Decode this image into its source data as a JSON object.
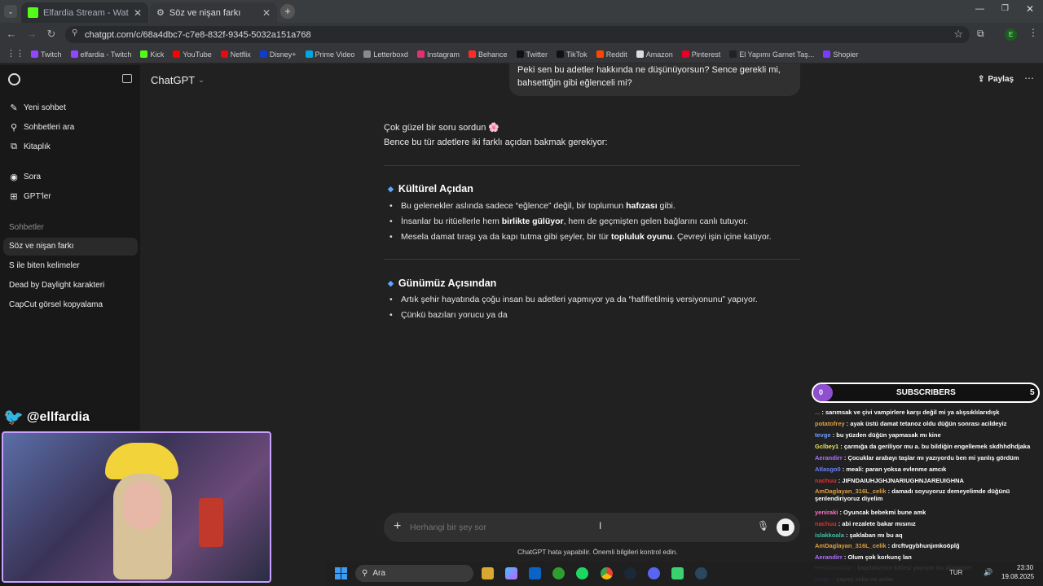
{
  "browser": {
    "tabs": [
      {
        "title": "Elfardia Stream - Watch Live or",
        "close": "✕",
        "active": false,
        "fav_color": "#53fc18"
      },
      {
        "title": "Söz ve nişan farkı",
        "close": "✕",
        "active": true,
        "fav_color": "#999999"
      }
    ],
    "new_tab": "+",
    "url": "chatgpt.com/c/68a4dbc7-c7e8-832f-9345-5032a151a768",
    "profile_letter": "E",
    "bookmarks": [
      {
        "label": "Twitch",
        "color": "#9146ff"
      },
      {
        "label": "elfardia - Twitch",
        "color": "#9146ff"
      },
      {
        "label": "Kick",
        "color": "#53fc18"
      },
      {
        "label": "YouTube",
        "color": "#ff0000"
      },
      {
        "label": "Netflix",
        "color": "#e50914"
      },
      {
        "label": "Disney+",
        "color": "#113ccf"
      },
      {
        "label": "Prime Video",
        "color": "#00a8e1"
      },
      {
        "label": "Letterboxd",
        "color": "#8a8a8a"
      },
      {
        "label": "Instagram",
        "color": "#e1306c"
      },
      {
        "label": "Behance",
        "color": "#ff2b2b"
      },
      {
        "label": "Twitter",
        "color": "#111111"
      },
      {
        "label": "TikTok",
        "color": "#111111"
      },
      {
        "label": "Reddit",
        "color": "#ff4500"
      },
      {
        "label": "Amazon",
        "color": "#dddddd"
      },
      {
        "label": "Pinterest",
        "color": "#e60023"
      },
      {
        "label": "El Yapımı Garnet Taş...",
        "color": "#222222"
      },
      {
        "label": "Shopier",
        "color": "#7a3cff"
      }
    ]
  },
  "sidebar": {
    "new_chat": "Yeni sohbet",
    "search": "Sohbetleri ara",
    "library": "Kitaplık",
    "sora": "Sora",
    "gpts": "GPT'ler",
    "section": "Sohbetler",
    "chats": [
      "Söz ve nişan farkı",
      "S ile biten kelimeler",
      "Dead by Daylight karakteri",
      "CapCut görsel kopyalama"
    ]
  },
  "header": {
    "model": "ChatGPT",
    "share": "Paylaş"
  },
  "conversation": {
    "user_message": "Peki sen bu adetler hakkında ne düşünüyorsun? Sence gerekli mi, bahsettiğin gibi eğlenceli mi?",
    "intro1": "Çok güzel bir soru sordun 🌸",
    "intro2": "Bence bu tür adetlere iki farklı açıdan bakmak gerekiyor:",
    "section1": {
      "title": "Kültürel Açıdan",
      "items": [
        {
          "pre": "Bu gelenekler aslında sadece “eğlence” değil, bir toplumun ",
          "bold": "hafızası",
          "post": " gibi."
        },
        {
          "pre": "İnsanlar bu ritüellerle hem ",
          "bold": "birlikte gülüyor",
          "post": ", hem de geçmişten gelen bağlarını canlı tutuyor."
        },
        {
          "pre": "Mesela damat tıraşı ya da kapı tutma gibi şeyler, bir tür ",
          "bold": "topluluk oyunu",
          "post": ". Çevreyi işin içine katıyor."
        }
      ]
    },
    "section2": {
      "title": "Günümüz Açısından",
      "items": [
        "Artık şehir hayatında çoğu insan bu adetleri yapmıyor ya da “hafifletilmiş versiyonunu” yapıyor.",
        "Çünkü bazıları yorucu ya da"
      ]
    }
  },
  "composer": {
    "placeholder": "Herhangi bir şey sor",
    "disclaimer": "ChatGPT hata yapabilir. Önemli bilgileri kontrol edin."
  },
  "stream_overlay": {
    "twitter_handle": "@ellfardia",
    "subs_left": "0",
    "subs_label": "SUBSCRIBERS",
    "subs_right": "5",
    "chat": [
      {
        "user": "...",
        "msg": "sarımsak ve çivi vampirlere karşı değil mi ya alışsıklılarıdışk",
        "color": "#e05050"
      },
      {
        "user": "potatofrey",
        "msg": "ayak üstü damat tetanoz oldu düğün sonrası acildeyiz",
        "color": "#e0a040"
      },
      {
        "user": "tevge",
        "msg": "bu yüzden düğün yapmasak mı kine",
        "color": "#6aa0ff"
      },
      {
        "user": "Gclbey1",
        "msg": "çarmığa da geriliyor mu a. bu bildiğin engellemek skdhhdhdjaka",
        "color": "#e8e060"
      },
      {
        "user": "Aerandirr",
        "msg": "Çocuklar arabayı taşlar mı yazıyordu ben mi yanlış gördüm",
        "color": "#b070ff"
      },
      {
        "user": "Atlasgo0",
        "msg": "meali: paran yoksa evlenme amcık",
        "color": "#6a80ff"
      },
      {
        "user": "nachuu",
        "msg": "JIFNDAIUHJGHJNARIUGHNJAREUIGHNA",
        "color": "#e03030"
      },
      {
        "user": "AmDaglayan_316L_celik",
        "msg": "damadı soyuyoruz demeyelimde düğünü şenlendiriyoruz diyelim",
        "color": "#e0a040"
      },
      {
        "user": "yeniraki",
        "msg": "Oyuncak bebekmi bune amk",
        "color": "#ff70c0"
      },
      {
        "user": "nachuu",
        "msg": "abi rezalete bakar mısınız",
        "color": "#e03030"
      },
      {
        "user": "islakkoala",
        "msg": "şaklaban mı bu aq",
        "color": "#40c0a0"
      },
      {
        "user": "AmDaglayan_316L_celik",
        "msg": "drcftvgybhunjımkoöplğ",
        "color": "#e0a040"
      },
      {
        "user": "Aerandirr",
        "msg": "Olum çok korkunç lan",
        "color": "#b070ff"
      },
      {
        "user": "Heybenelnur",
        "msg": "kapitalizmin kölesi yapıyor bu düğünler",
        "color": "#70c0ff"
      },
      {
        "user": "tevge",
        "msg": "yapay zeka ne anlar",
        "color": "#6aa0ff"
      }
    ]
  },
  "taskbar": {
    "search": "Ara",
    "lang": "TUR",
    "time": "23:30",
    "date": "19.08.2025"
  }
}
